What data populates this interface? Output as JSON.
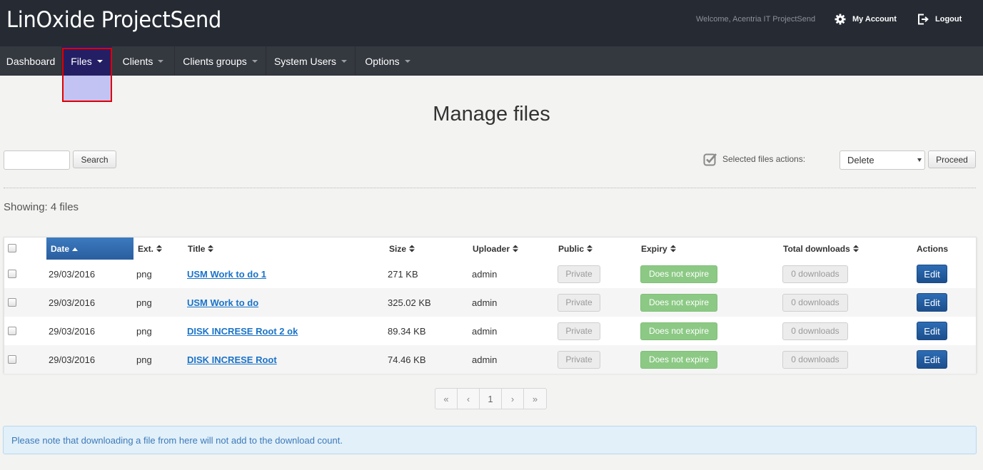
{
  "app": {
    "brand": "LinOxide ProjectSend",
    "welcome": "Welcome, Acentria IT ProjectSend",
    "my_account": "My Account",
    "logout": "Logout"
  },
  "nav": {
    "items": [
      {
        "label": "Dashboard"
      },
      {
        "label": "Files"
      },
      {
        "label": "Clients"
      },
      {
        "label": "Clients groups"
      },
      {
        "label": "System Users"
      },
      {
        "label": "Options"
      }
    ]
  },
  "page": {
    "title": "Manage files",
    "search_button": "Search",
    "search_value": "",
    "selected_actions_label": "Selected files actions:",
    "action_select": "Delete",
    "proceed_button": "Proceed",
    "showing": "Showing: 4 files"
  },
  "table": {
    "headers": {
      "date": "Date",
      "ext": "Ext.",
      "title": "Title",
      "size": "Size",
      "uploader": "Uploader",
      "public": "Public",
      "expiry": "Expiry",
      "downloads": "Total downloads",
      "actions": "Actions"
    },
    "rows": [
      {
        "date": "29/03/2016",
        "ext": "png",
        "title": "USM Work to do 1",
        "size": "271 KB",
        "uploader": "admin",
        "public": "Private",
        "expiry": "Does not expire",
        "downloads": "0 downloads",
        "action": "Edit"
      },
      {
        "date": "29/03/2016",
        "ext": "png",
        "title": "USM Work to do",
        "size": "325.02 KB",
        "uploader": "admin",
        "public": "Private",
        "expiry": "Does not expire",
        "downloads": "0 downloads",
        "action": "Edit"
      },
      {
        "date": "29/03/2016",
        "ext": "png",
        "title": "DISK INCRESE Root 2 ok",
        "size": "89.34 KB",
        "uploader": "admin",
        "public": "Private",
        "expiry": "Does not expire",
        "downloads": "0 downloads",
        "action": "Edit"
      },
      {
        "date": "29/03/2016",
        "ext": "png",
        "title": "DISK INCRESE Root",
        "size": "74.46 KB",
        "uploader": "admin",
        "public": "Private",
        "expiry": "Does not expire",
        "downloads": "0 downloads",
        "action": "Edit"
      }
    ]
  },
  "pagination": {
    "first": "«",
    "prev": "‹",
    "current": "1",
    "next": "›",
    "last": "»"
  },
  "notice": "Please note that downloading a file from here will not add to the download count.",
  "colors": {
    "topbar": "#252a33",
    "navbar": "#34383f",
    "active_nav": "#241f64",
    "highlight_border": "#e00000",
    "sorted_header": "#3c7abf",
    "expire_badge": "#8cc985",
    "edit_button": "#2d6db5",
    "link": "#1a73c9"
  },
  "icons": {
    "my_account": "gear-icon",
    "logout": "logout-icon",
    "selected_actions": "check-square-icon",
    "sort": "sort-icon"
  }
}
